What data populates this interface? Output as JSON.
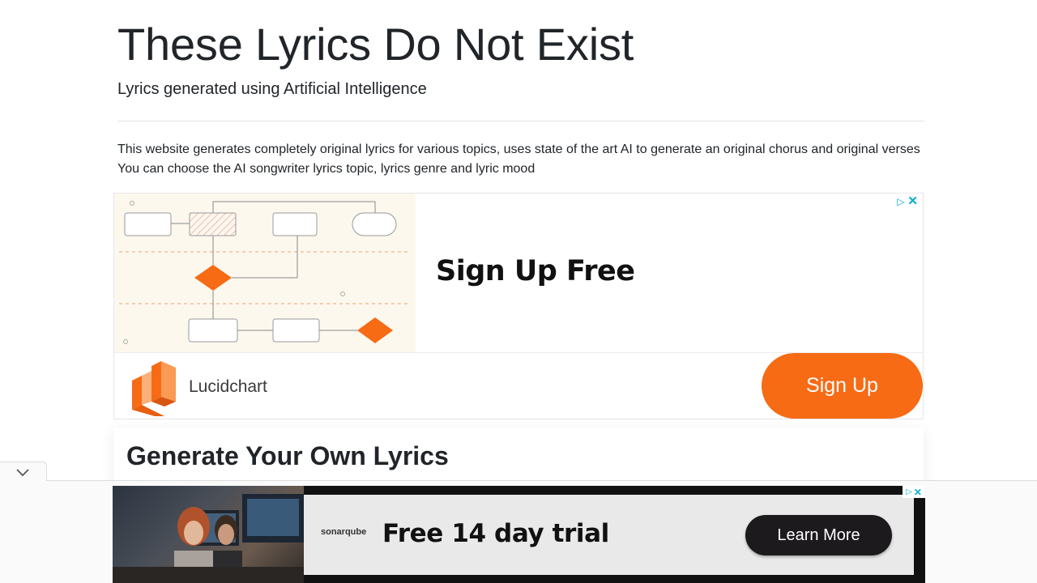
{
  "header": {
    "title": "These Lyrics Do Not Exist",
    "subtitle": "Lyrics generated using Artificial Intelligence"
  },
  "intro": {
    "line1": "This website generates completely original lyrics for various topics, uses state of the art AI to generate an original chorus and original verses",
    "line2": "You can choose the AI songwriter lyrics topic, lyrics genre and lyric mood"
  },
  "ad_top": {
    "headline": "Sign Up Free",
    "brand": "Lucidchart",
    "cta": "Sign Up",
    "choices_play_icon": "ad-choices-icon",
    "close_icon": "close-icon",
    "accent_color": "#f76b15"
  },
  "generator": {
    "title": "Generate Your Own Lyrics"
  },
  "ad_bottom": {
    "logo": "sonarqube",
    "headline": "Free 14 day trial",
    "cta": "Learn More",
    "collapse_icon": "chevron-down-icon"
  }
}
